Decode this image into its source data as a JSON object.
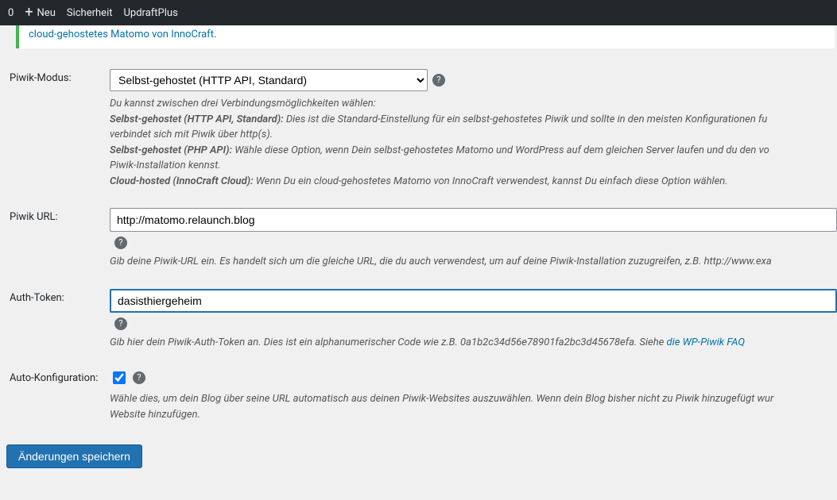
{
  "adminbar": {
    "count": "0",
    "new_label": "Neu",
    "security_label": "Sicherheit",
    "updraft_label": "UpdraftPlus"
  },
  "notice": {
    "link_text": "cloud-gehostetes Matomo von InnoCraft",
    "suffix": "."
  },
  "piwik_mode": {
    "label": "Piwik-Modus:",
    "selected": "Selbst-gehostet (HTTP API, Standard)",
    "desc_intro": "Du kannst zwischen drei Verbindungsmöglichkeiten wählen:",
    "opt1_title": "Selbst-gehostet (HTTP API, Standard):",
    "opt1_text": " Dies ist die Standard-Einstellung für ein selbst-gehostetes Piwik und sollte in den meisten Konfigurationen fu",
    "opt1_line2": "verbindet sich mit Piwik über http(s).",
    "opt2_title": "Selbst-gehostet (PHP API):",
    "opt2_text": " Wähle diese Option, wenn Dein selbst-gehostetes Matomo und WordPress auf dem gleichen Server laufen und du den vo",
    "opt2_line2": "Piwik-Installation kennst.",
    "opt3_title": "Cloud-hosted (InnoCraft Cloud):",
    "opt3_text": " Wenn Du ein cloud-gehostetes Matomo von InnoCraft verwendest, kannst Du einfach diese Option wählen."
  },
  "piwik_url": {
    "label": "Piwik URL:",
    "value": "http://matomo.relaunch.blog",
    "desc": "Gib deine Piwik-URL ein. Es handelt sich um die gleiche URL, die du auch verwendest, um auf deine Piwik-Installation zuzugreifen, z.B. http://www.exa"
  },
  "auth_token": {
    "label": "Auth-Token:",
    "value": "dasisthiergeheim",
    "desc": "Gib hier dein Piwik-Auth-Token an. Dies ist ein alphanumerischer Code wie z.B. 0a1b2c34d56e78901fa2bc3d45678efa. Siehe ",
    "faq_link": "die WP-Piwik FAQ"
  },
  "auto_config": {
    "label": "Auto-Konfiguration:",
    "desc": "Wähle dies, um dein Blog über seine URL automatisch aus deinen Piwik-Websites auszuwählen. Wenn dein Blog bisher nicht zu Piwik hinzugefügt wur",
    "desc_line2": "Website hinzufügen."
  },
  "submit": {
    "label": "Änderungen speichern"
  }
}
